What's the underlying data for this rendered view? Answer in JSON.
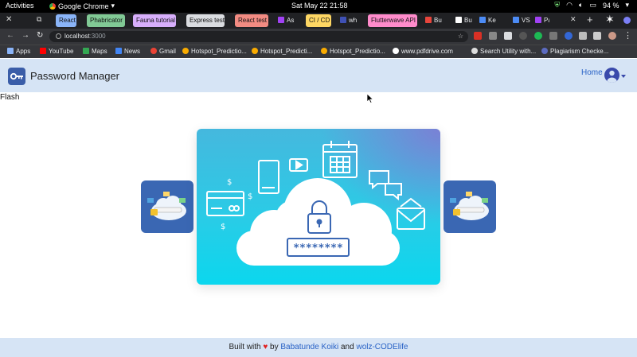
{
  "system_bar": {
    "activities": "Activities",
    "app_name": "Google Chrome",
    "clock": "Sat May 22  21:58",
    "battery": "94 %"
  },
  "tabs": [
    {
      "label": "React",
      "color": "#8ab4f8"
    },
    {
      "label": "Phabricator",
      "color": "#81c995"
    },
    {
      "label": "Fauna tutorial",
      "color": "#d7aefb"
    },
    {
      "label": "Express test",
      "color": "#dadce0"
    },
    {
      "label": "React test",
      "color": "#f28b82"
    },
    {
      "label": "As",
      "color": ""
    },
    {
      "label": "CI / CD",
      "color": "#fdd663"
    },
    {
      "label": "wh",
      "color": ""
    },
    {
      "label": "Flutterwave API",
      "color": "#ff8bcb"
    },
    {
      "label": "Bu",
      "color": ""
    },
    {
      "label": "Bu",
      "color": ""
    },
    {
      "label": "Ke",
      "color": ""
    },
    {
      "label": "VS",
      "color": ""
    },
    {
      "label": "Pa",
      "color": ""
    }
  ],
  "omnibox": {
    "host": "localhost",
    "port": ":3000"
  },
  "bookmarks": [
    {
      "label": "Apps"
    },
    {
      "label": "YouTube"
    },
    {
      "label": "Maps"
    },
    {
      "label": "News"
    },
    {
      "label": "Gmail"
    },
    {
      "label": "Hotspot_Predictio..."
    },
    {
      "label": "Hotspot_Predicti..."
    },
    {
      "label": "Hotspot_Predictio..."
    },
    {
      "label": "www.pdfdrive.com"
    },
    {
      "label": "Search Utility with..."
    },
    {
      "label": "Plagiarism Checke..."
    }
  ],
  "navbar": {
    "brand": "Password Manager",
    "home": "Home"
  },
  "flash_text": "Flash",
  "hero": {
    "password_mask": "********"
  },
  "footer": {
    "built_with": "Built with",
    "by": "by",
    "author1": "Babatunde Koiki",
    "and": "and",
    "author2": "wolz-CODElife"
  },
  "colors": {
    "navbar_bg": "#d6e4f5",
    "link": "#2962c6",
    "hero_gradient_top": "#45b8de",
    "hero_gradient_bottom": "#0bd7ee",
    "brand_icon": "#3a5da8"
  }
}
